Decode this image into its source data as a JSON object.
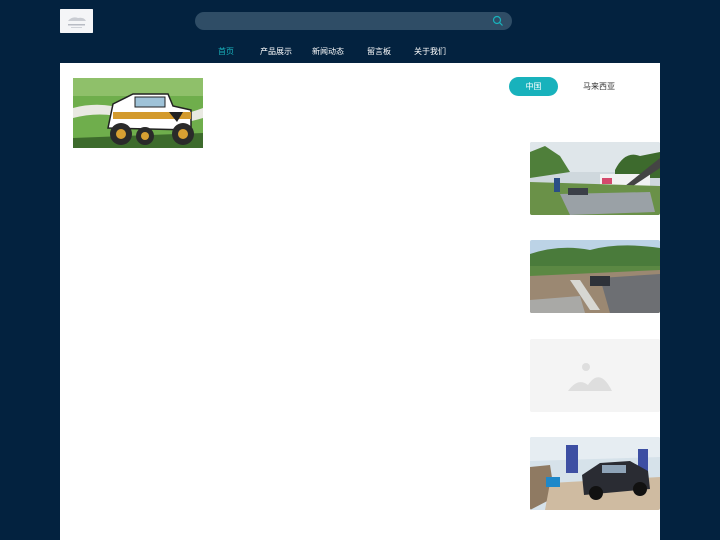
{
  "nav": {
    "items": [
      {
        "label": "首页",
        "active": true
      },
      {
        "label": "产品展示",
        "active": false
      },
      {
        "label": "新闻动态",
        "active": false
      },
      {
        "label": "留言板",
        "active": false
      },
      {
        "label": "关于我们",
        "active": false
      }
    ]
  },
  "search": {
    "placeholder": ""
  },
  "language": {
    "options": [
      "中国",
      "马来西亚"
    ],
    "selected": "中国"
  },
  "gallery": {
    "items": [
      {
        "icon": "photo-offroad-course-building"
      },
      {
        "icon": "photo-gravel-track-hills"
      },
      {
        "icon": "image-placeholder-icon"
      },
      {
        "icon": "photo-suv-on-ramp"
      }
    ]
  },
  "colors": {
    "background": "#03223f",
    "accent": "#18b2bc",
    "search": "#2f4d66"
  }
}
